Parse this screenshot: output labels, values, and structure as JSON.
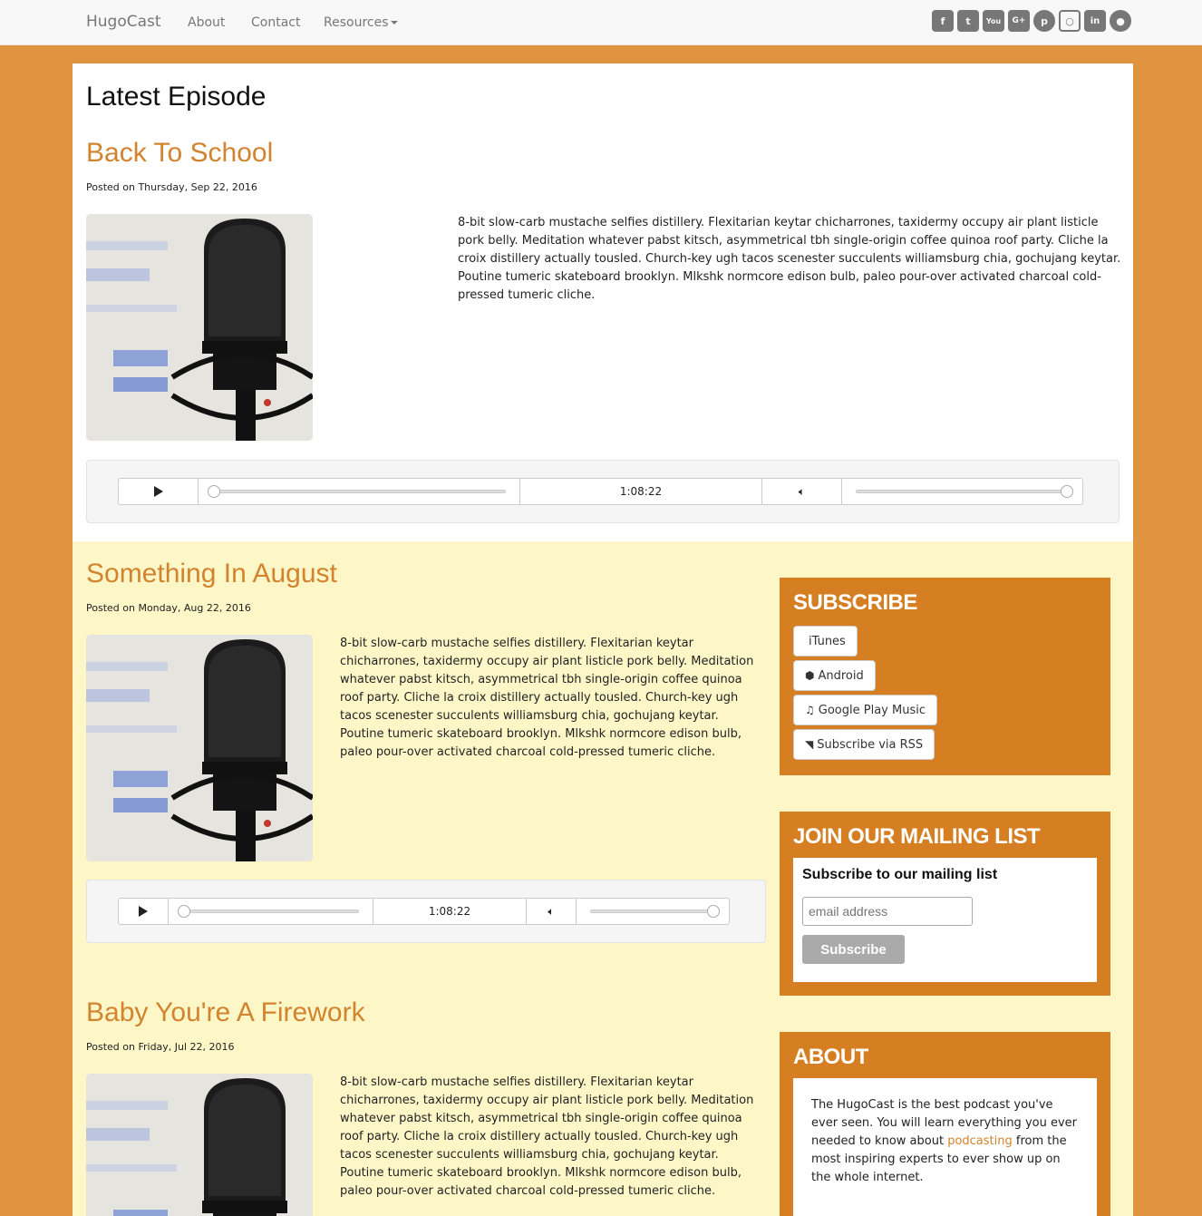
{
  "nav": {
    "brand": "HugoCast",
    "links": [
      "About",
      "Contact",
      "Resources"
    ],
    "social": [
      "facebook-icon",
      "twitter-icon",
      "youtube-icon",
      "google-plus-icon",
      "pinterest-icon",
      "instagram-icon",
      "linkedin-icon",
      "github-icon"
    ]
  },
  "latest": {
    "heading": "Latest Episode",
    "episode": {
      "title": "Back To School",
      "posted": "Posted on Thursday, Sep 22, 2016",
      "description": "8-bit slow-carb mustache selfies distillery. Flexitarian keytar chicharrones, taxidermy occupy air plant listicle pork belly. Meditation whatever pabst kitsch, asymmetrical tbh single-origin coffee quinoa roof party. Cliche la croix distillery actually tousled. Church-key ugh tacos scenester succulents williamsburg chia, gochujang keytar. Poutine tumeric skateboard brooklyn. Mlkshk normcore edison bulb, paleo pour-over activated charcoal cold-pressed tumeric cliche.",
      "duration": "1:08:22"
    }
  },
  "episodes": [
    {
      "title": "Something In August",
      "posted": "Posted on Monday, Aug 22, 2016",
      "description": "8-bit slow-carb mustache selfies distillery. Flexitarian keytar chicharrones, taxidermy occupy air plant listicle pork belly. Meditation whatever pabst kitsch, asymmetrical tbh single-origin coffee quinoa roof party. Cliche la croix distillery actually tousled. Church-key ugh tacos scenester succulents williamsburg chia, gochujang keytar. Poutine tumeric skateboard brooklyn. Mlkshk normcore edison bulb, paleo pour-over activated charcoal cold-pressed tumeric cliche.",
      "duration": "1:08:22"
    },
    {
      "title": "Baby You're A Firework",
      "posted": "Posted on Friday, Jul 22, 2016",
      "description": "8-bit slow-carb mustache selfies distillery. Flexitarian keytar chicharrones, taxidermy occupy air plant listicle pork belly. Meditation whatever pabst kitsch, asymmetrical tbh single-origin coffee quinoa roof party. Cliche la croix distillery actually tousled. Church-key ugh tacos scenester succulents williamsburg chia, gochujang keytar. Poutine tumeric skateboard brooklyn. Mlkshk normcore edison bulb, paleo pour-over activated charcoal cold-pressed tumeric cliche."
    }
  ],
  "sidebar": {
    "subscribe": {
      "title": "SUBSCRIBE",
      "buttons": [
        "iTunes",
        "Android",
        "Google Play Music",
        "Subscribe via RSS"
      ]
    },
    "mailing": {
      "title": "JOIN OUR MAILING LIST",
      "subtitle": "Subscribe to our mailing list",
      "placeholder": "email address",
      "button": "Subscribe"
    },
    "about": {
      "title": "ABOUT",
      "text_before": "The HugoCast is the best podcast you've ever seen. You will learn everything you ever needed to know about ",
      "link": "podcasting",
      "text_after": " from the most inspiring experts to ever show up on the whole internet."
    }
  },
  "colors": {
    "page_bg": "#e09440",
    "accent": "#d2832e",
    "panel": "#d57f22",
    "lower_bg": "#fdf7c8"
  }
}
